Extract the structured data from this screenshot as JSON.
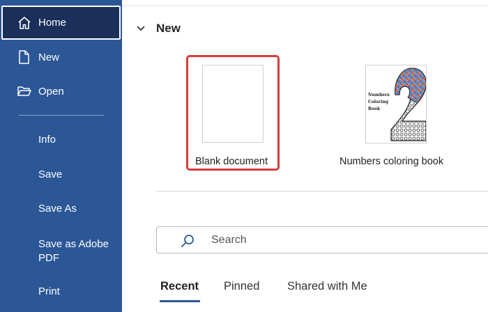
{
  "sidebar": {
    "items": [
      {
        "label": "Home",
        "icon": "home-icon"
      },
      {
        "label": "New",
        "icon": "new-document-icon"
      },
      {
        "label": "Open",
        "icon": "folder-open-icon"
      },
      {
        "label": "Info"
      },
      {
        "label": "Save"
      },
      {
        "label": "Save As"
      },
      {
        "label": "Save as Adobe PDF"
      },
      {
        "label": "Print"
      }
    ],
    "active": "Home",
    "background_color": "#2b5797",
    "active_color": "#1b2f5b"
  },
  "main": {
    "section_title": "New",
    "templates": [
      {
        "label": "Blank document",
        "selected": true
      },
      {
        "label": "Numbers coloring book",
        "thumbnail_text": "Numbers Coloring Book"
      }
    ],
    "selection_color": "#d83b3b",
    "search": {
      "placeholder": "Search"
    },
    "tabs": [
      {
        "label": "Recent",
        "active": true
      },
      {
        "label": "Pinned"
      },
      {
        "label": "Shared with Me"
      }
    ]
  }
}
